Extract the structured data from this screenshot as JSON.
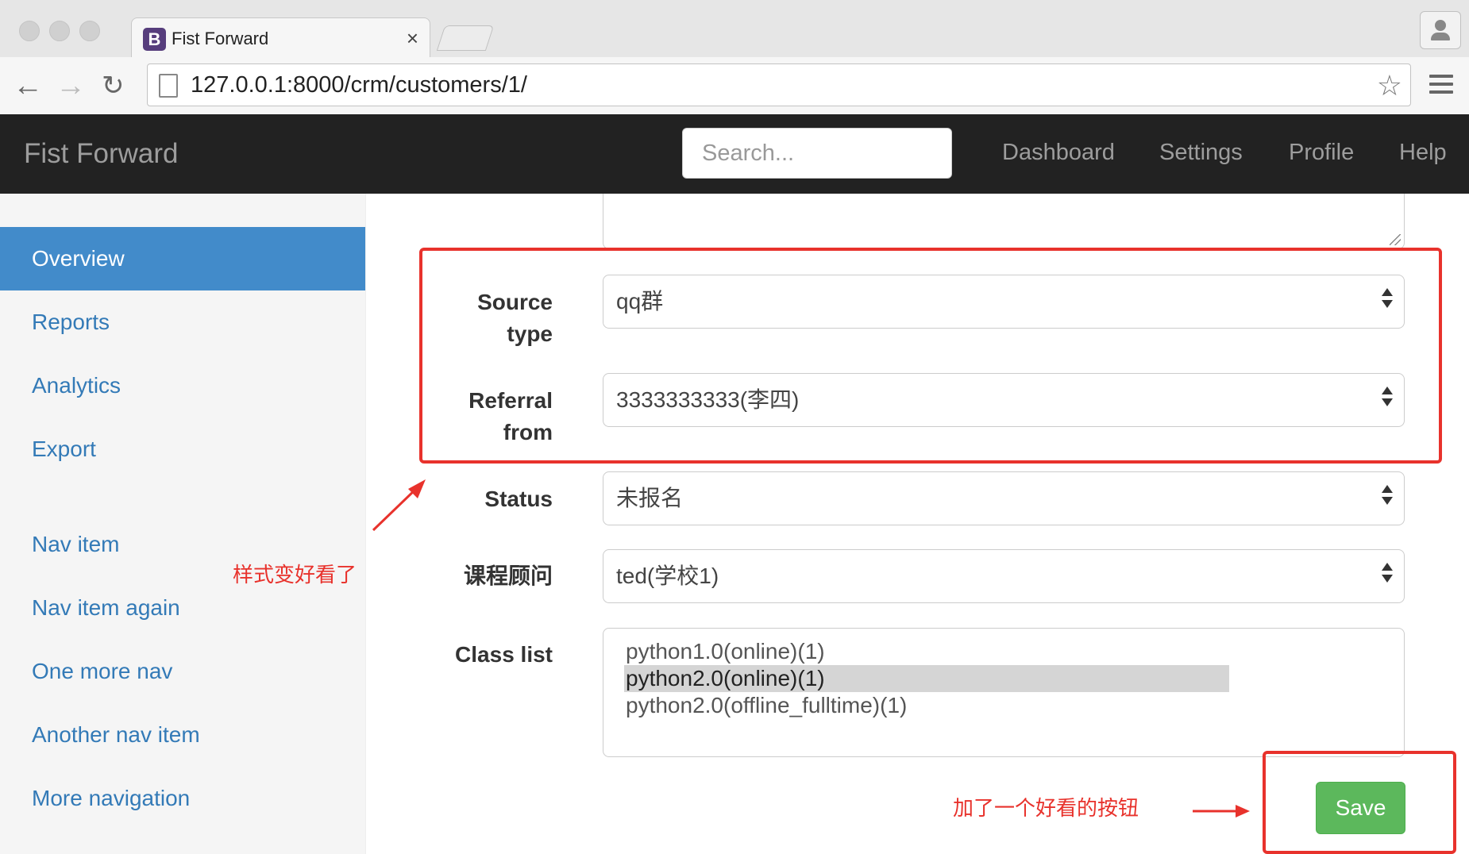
{
  "browser": {
    "tab_title": "Fist Forward",
    "tab_favicon_letter": "B",
    "tab_close": "×",
    "url": "127.0.0.1:8000/crm/customers/1/",
    "back_icon": "arrow-left-icon",
    "forward_icon": "arrow-right-icon",
    "reload_icon": "reload-icon"
  },
  "navbar": {
    "brand": "Fist Forward",
    "search_placeholder": "Search...",
    "links": [
      "Dashboard",
      "Settings",
      "Profile",
      "Help"
    ]
  },
  "sidebar": {
    "items": [
      "Overview",
      "Reports",
      "Analytics",
      "Export",
      "Nav item",
      "Nav item again",
      "One more nav",
      "Another nav item",
      "More navigation"
    ],
    "active": "Overview"
  },
  "form": {
    "source_type": {
      "label_line1": "Source",
      "label_line2": "type",
      "value": "qq群"
    },
    "referral_from": {
      "label_line1": "Referral",
      "label_line2": "from",
      "value": "3333333333(李四)"
    },
    "status": {
      "label": "Status",
      "value": "未报名"
    },
    "consultant": {
      "label": "课程顾问",
      "value": "ted(学校1)"
    },
    "class_list": {
      "label": "Class list",
      "options": [
        "python1.0(online)(1)",
        "python2.0(online)(1)",
        "python2.0(offline_fulltime)(1)"
      ],
      "selected": "python2.0(online)(1)"
    },
    "save_label": "Save"
  },
  "annotations": {
    "style_note": "样式变好看了",
    "button_note": "加了一个好看的按钮",
    "color": "#e8322c"
  },
  "colors": {
    "navbar_bg": "#222222",
    "sidebar_active": "#428bca",
    "link": "#337ab7",
    "save_button": "#5cb85c"
  }
}
